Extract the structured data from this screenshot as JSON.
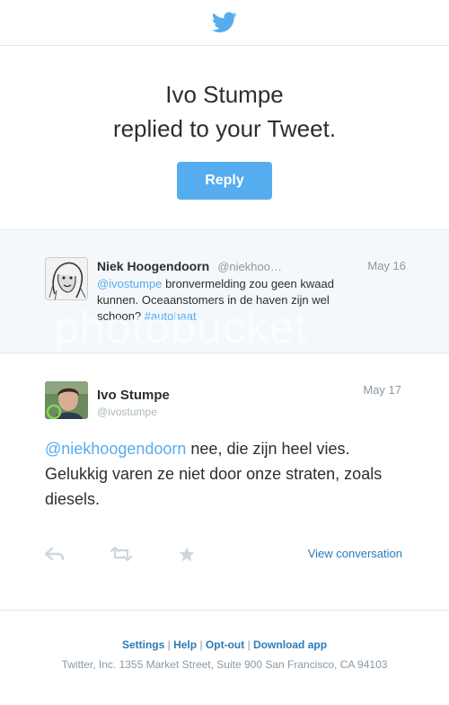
{
  "notification": {
    "title_line1": "Ivo Stumpe",
    "title_line2": "replied to your Tweet.",
    "reply_label": "Reply"
  },
  "original_tweet": {
    "author_name": "Niek Hoogendoorn",
    "author_handle": "@niekhoo…",
    "date": "May 16",
    "mention": "@ivostumpe",
    "text_after_mention": " bronvermelding zou geen kwaad kunnen. Oceaanstomers in de haven zijn wel schoon? ",
    "hashtag": "#autohaat"
  },
  "reply_tweet": {
    "author_name": "Ivo Stumpe",
    "author_handle": "@ivostumpe",
    "date": "May 17",
    "mention": "@niekhoogendoorn",
    "text_after_mention": " nee, die zijn heel vies. Gelukkig varen ze niet door onze straten, zoals diesels.",
    "view_conversation_label": "View conversation"
  },
  "footer": {
    "links": [
      "Settings",
      "Help",
      "Opt-out",
      "Download app"
    ],
    "address": "Twitter, Inc. 1355 Market Street, Suite 900 San Francisco, CA 94103"
  },
  "watermark": "photobucket",
  "colors": {
    "twitter_blue": "#55acee",
    "link_blue": "#2b7bb9",
    "muted_gray": "#8899a6",
    "light_bg": "#f5f8fa"
  }
}
